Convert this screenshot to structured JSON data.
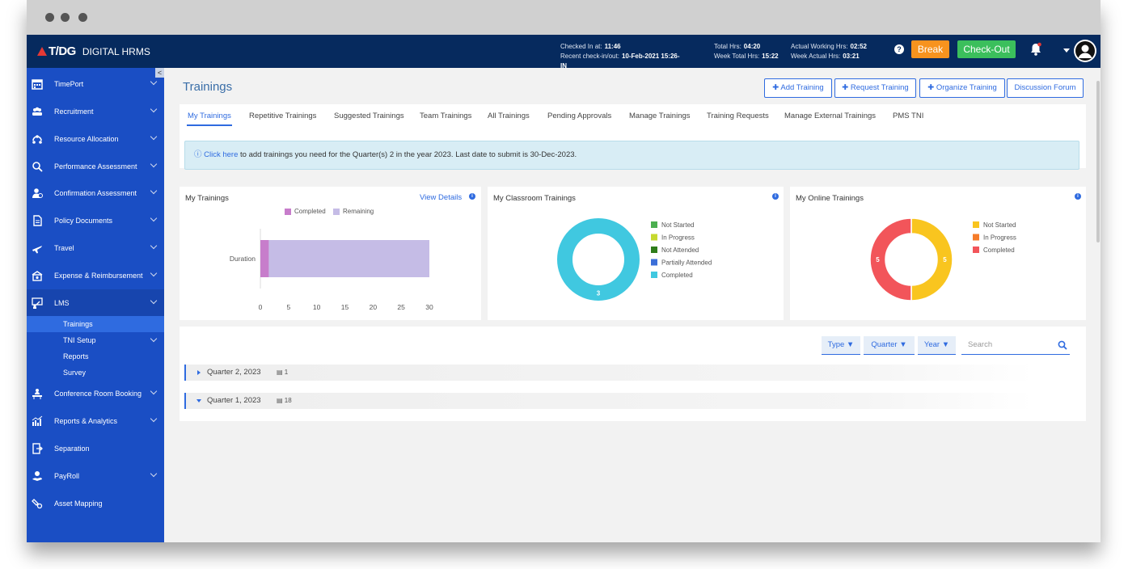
{
  "app": {
    "brand": "T/DG",
    "name": "DIGITAL HRMS"
  },
  "header": {
    "checked_in_label": "Checked In at:",
    "checked_in_value": "11:46",
    "recent_label": "Recent check-in/out:",
    "recent_value": "10-Feb-2021 15:26-IN",
    "total_hrs_label": "Total Hrs:",
    "total_hrs_value": "04:20",
    "week_total_label": "Week Total Hrs:",
    "week_total_value": "15:22",
    "actual_label": "Actual Working Hrs:",
    "actual_value": "02:52",
    "week_actual_label": "Week Actual Hrs:",
    "week_actual_value": "03:21",
    "help": "?",
    "break_label": "Break",
    "checkout_label": "Check-Out"
  },
  "sidebar": {
    "collapse": "<",
    "items": [
      {
        "label": "TimePort",
        "icon": "calendar-icon"
      },
      {
        "label": "Recruitment",
        "icon": "people-icon"
      },
      {
        "label": "Resource Allocation",
        "icon": "network-icon"
      },
      {
        "label": "Performance Assessment",
        "icon": "magnifier-icon"
      },
      {
        "label": "Confirmation Assessment",
        "icon": "user-check-icon"
      },
      {
        "label": "Policy Documents",
        "icon": "document-icon"
      },
      {
        "label": "Travel",
        "icon": "plane-icon"
      },
      {
        "label": "Expense & Reimbursement",
        "icon": "money-icon"
      },
      {
        "label": "LMS",
        "icon": "classroom-icon"
      },
      {
        "label": "Conference Room Booking",
        "icon": "meeting-icon"
      },
      {
        "label": "Reports & Analytics",
        "icon": "analytics-icon"
      },
      {
        "label": "Separation",
        "icon": "exit-icon"
      },
      {
        "label": "PayRoll",
        "icon": "payroll-icon"
      },
      {
        "label": "Asset Mapping",
        "icon": "asset-icon"
      }
    ],
    "lms_sub": [
      "Trainings",
      "TNI Setup",
      "Reports",
      "Survey"
    ]
  },
  "page": {
    "title": "Trainings",
    "actions": [
      "Add Training",
      "Request Training",
      "Organize Training",
      "Discussion Forum"
    ],
    "tabs": [
      "My Trainings",
      "Repetitive Trainings",
      "Suggested Trainings",
      "Team Trainings",
      "All Trainings",
      "Pending Approvals",
      "Manage Trainings",
      "Training Requests",
      "Manage External Trainings",
      "PMS TNI"
    ],
    "notice": {
      "link": "Click here",
      "text": " to add trainings you need for the Quarter(s) 2 in the year 2023. Last date to submit is 30-Dec-2023."
    }
  },
  "cards": {
    "my_trainings": {
      "title": "My Trainings",
      "view_details": "View Details"
    },
    "classroom": {
      "title": "My Classroom Trainings"
    },
    "online": {
      "title": "My Online Trainings"
    }
  },
  "chart_data": [
    {
      "type": "bar",
      "orientation": "horizontal",
      "stacked": true,
      "categories": [
        "Duration"
      ],
      "series": [
        {
          "name": "Completed",
          "values": [
            1.5
          ],
          "color": "#c77dcb"
        },
        {
          "name": "Remaining",
          "values": [
            28.5
          ],
          "color": "#c5bce6"
        }
      ],
      "xlim": [
        0,
        30
      ],
      "xticks": [
        "0",
        "5",
        "10",
        "15",
        "20",
        "25",
        "30"
      ],
      "legend": "top"
    },
    {
      "type": "pie",
      "donut": true,
      "slices": [
        {
          "name": "Not Started",
          "value": 0,
          "color": "#4caf50"
        },
        {
          "name": "In Progress",
          "value": 0,
          "color": "#c6d92f"
        },
        {
          "name": "Not Attended",
          "value": 0,
          "color": "#2e7d1a"
        },
        {
          "name": "Partially Attended",
          "value": 0,
          "color": "#3b6fd8"
        },
        {
          "name": "Completed",
          "value": 3,
          "color": "#40c8e0"
        }
      ],
      "labels": [
        "3"
      ],
      "legend": "right"
    },
    {
      "type": "pie",
      "donut": true,
      "slices": [
        {
          "name": "Not Started",
          "value": 5,
          "color": "#f9c51f"
        },
        {
          "name": "In Progress",
          "value": 0,
          "color": "#f57c2a"
        },
        {
          "name": "Completed",
          "value": 5,
          "color": "#f2555a"
        }
      ],
      "labels": [
        "5",
        "5"
      ],
      "legend": "right"
    }
  ],
  "filters": {
    "type": "Type",
    "quarter": "Quarter",
    "year": "Year",
    "search_placeholder": "Search"
  },
  "quarters": [
    {
      "label": "Quarter 2, 2023",
      "count": "1",
      "expanded": false
    },
    {
      "label": "Quarter 1, 2023",
      "count": "18",
      "expanded": true
    }
  ]
}
